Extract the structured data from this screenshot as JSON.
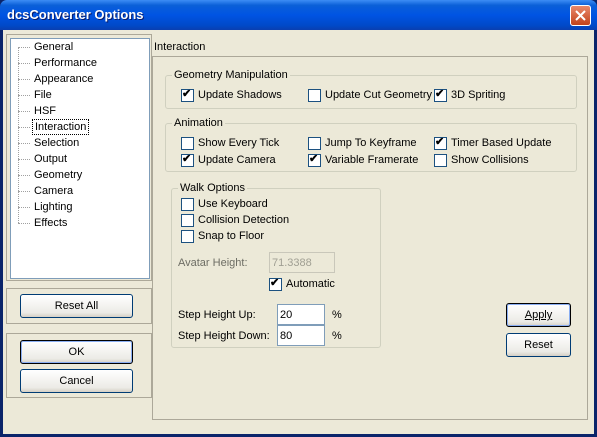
{
  "window": {
    "title": "dcsConverter Options"
  },
  "tree": {
    "items": [
      "General",
      "Performance",
      "Appearance",
      "File",
      "HSF",
      "Interaction",
      "Selection",
      "Output",
      "Geometry",
      "Camera",
      "Lighting",
      "Effects"
    ],
    "selected": "Interaction"
  },
  "buttons": {
    "reset_all": "Reset All",
    "ok": "OK",
    "cancel": "Cancel",
    "apply": "Apply",
    "reset": "Reset"
  },
  "page": {
    "header": "Interaction"
  },
  "geometry": {
    "title": "Geometry Manipulation",
    "update_shadows": {
      "label": "Update Shadows",
      "checked": true
    },
    "update_cut_geometry": {
      "label": "Update Cut Geometry",
      "checked": false
    },
    "spriting_3d": {
      "label": "3D Spriting",
      "checked": true
    }
  },
  "animation": {
    "title": "Animation",
    "show_every_tick": {
      "label": "Show Every Tick",
      "checked": false
    },
    "jump_to_keyframe": {
      "label": "Jump To Keyframe",
      "checked": false
    },
    "timer_based_update": {
      "label": "Timer Based Update",
      "checked": true
    },
    "update_camera": {
      "label": "Update Camera",
      "checked": true
    },
    "variable_framerate": {
      "label": "Variable Framerate",
      "checked": true
    },
    "show_collisions": {
      "label": "Show Collisions",
      "checked": false
    }
  },
  "walk": {
    "title": "Walk Options",
    "use_keyboard": {
      "label": "Use Keyboard",
      "checked": false
    },
    "collision_detection": {
      "label": "Collision Detection",
      "checked": false
    },
    "snap_to_floor": {
      "label": "Snap to Floor",
      "checked": false
    },
    "avatar_height_label": "Avatar Height:",
    "avatar_height_value": "71.3388",
    "automatic": {
      "label": "Automatic",
      "checked": true
    },
    "step_up_label": "Step Height Up:",
    "step_up_value": "20",
    "step_up_unit": "%",
    "step_down_label": "Step Height Down:",
    "step_down_value": "80",
    "step_down_unit": "%"
  },
  "check_mark": "✔"
}
